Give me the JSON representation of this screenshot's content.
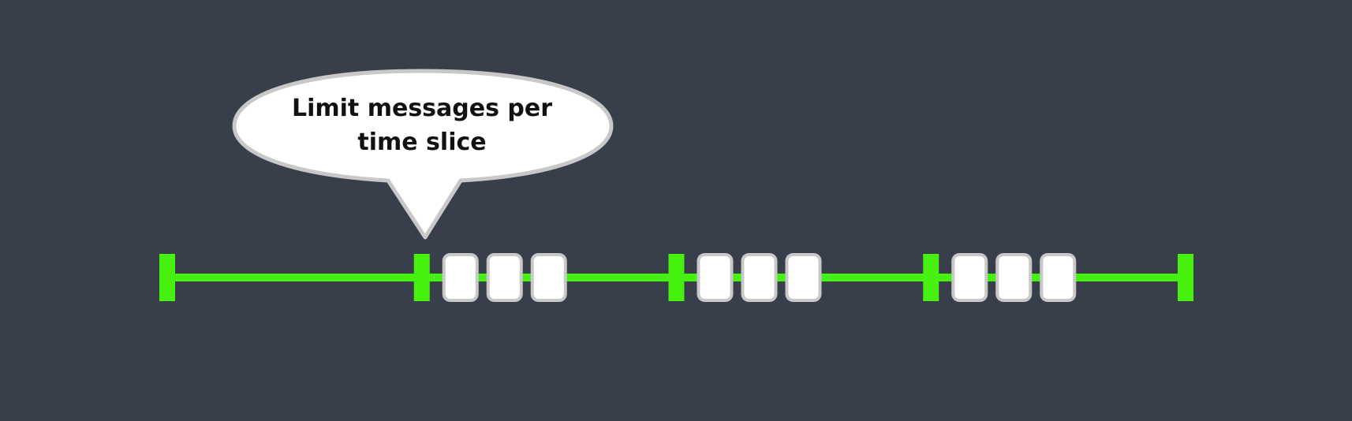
{
  "colors": {
    "background": "#383f4a",
    "timeline": "#46f00f",
    "message_fill": "#ffffff",
    "message_border": "#c8c8c8",
    "bubble_fill": "#ffffff",
    "bubble_border": "#c8c8c8"
  },
  "callout": {
    "line1": "Limit messages per",
    "line2": "time slice"
  },
  "timeline": {
    "time_slices": 4,
    "messages_per_slice": [
      0,
      3,
      3,
      3
    ]
  }
}
